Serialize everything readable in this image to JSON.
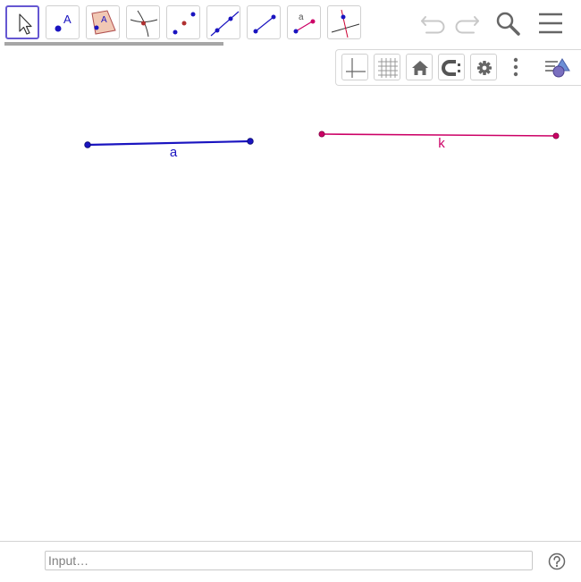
{
  "toolbar": {
    "tools": [
      {
        "icon": "move-icon",
        "selected": true
      },
      {
        "icon": "point-icon",
        "label": "A"
      },
      {
        "icon": "polygon-icon",
        "label": "A"
      },
      {
        "icon": "intersect-icon"
      },
      {
        "icon": "point-on-object-icon"
      },
      {
        "icon": "line-icon"
      },
      {
        "icon": "segment-icon"
      },
      {
        "icon": "segment-length-icon",
        "label": "a"
      },
      {
        "icon": "perpendicular-line-icon"
      }
    ],
    "right_icons": [
      "undo-icon",
      "redo-icon",
      "search-icon",
      "menu-icon"
    ]
  },
  "view_bar": {
    "buttons": [
      "axes-icon",
      "grid-icon",
      "home-icon",
      "point-capturing-icon",
      "settings-icon",
      "more-icon",
      "style-bar-toggle-icon"
    ]
  },
  "graphics": {
    "objects": [
      {
        "name": "a",
        "type": "segment",
        "color": "#1a14c0"
      },
      {
        "name": "k",
        "type": "segment",
        "color": "#cc0066"
      }
    ]
  },
  "input_bar": {
    "placeholder": "Input…",
    "value": "",
    "help_icon": "help-icon"
  },
  "colors": {
    "accent": "#6557d2",
    "segment_a": "#1a14c0",
    "segment_k": "#cc0066"
  }
}
